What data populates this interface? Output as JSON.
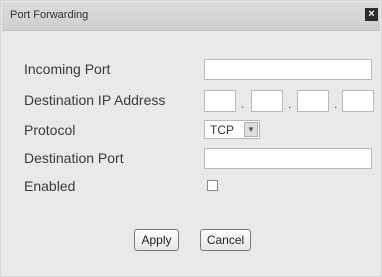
{
  "dialog": {
    "title": "Port Forwarding",
    "close_glyph": "×"
  },
  "form": {
    "incoming_port": {
      "label": "Incoming Port",
      "value": ""
    },
    "destination_ip": {
      "label": "Destination IP Address",
      "octets": [
        "",
        "",
        "",
        ""
      ],
      "separator": "."
    },
    "protocol": {
      "label": "Protocol",
      "value": "TCP",
      "arrow_glyph": "▼"
    },
    "destination_port": {
      "label": "Destination Port",
      "value": ""
    },
    "enabled": {
      "label": "Enabled",
      "checked": false
    }
  },
  "buttons": {
    "apply": "Apply",
    "cancel": "Cancel"
  }
}
